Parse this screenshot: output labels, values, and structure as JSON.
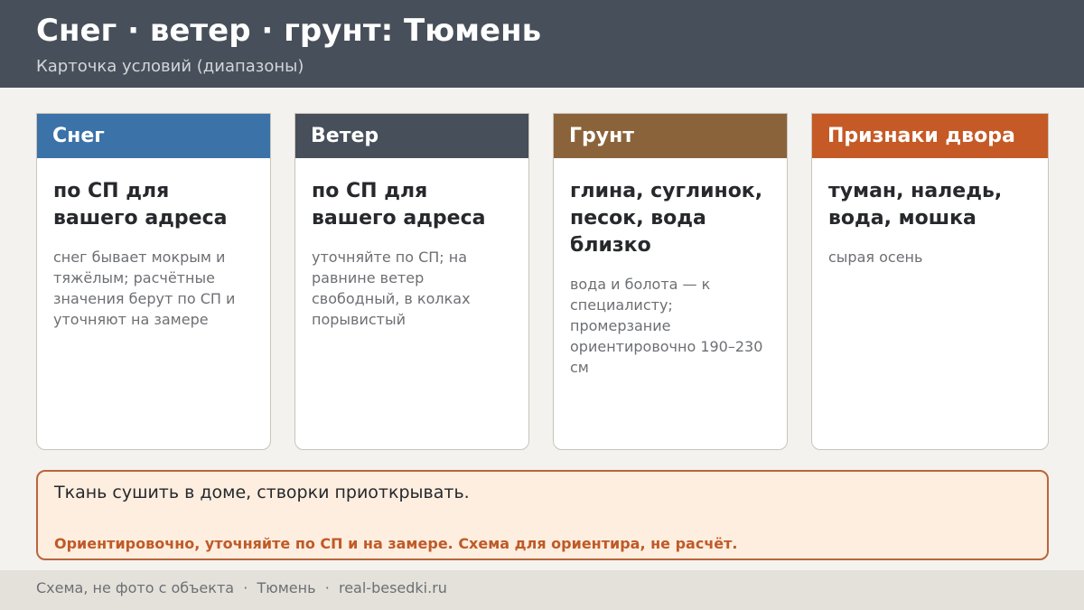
{
  "header": {
    "title": "Снег · ветер · грунт: Тюмень",
    "subtitle": "Карточка условий (диапазоны)"
  },
  "cards": [
    {
      "heading": "Снег",
      "color": "#3b72a8",
      "main": "по СП для вашего адреса",
      "note": "снег бывает мокрым и тяжёлым; расчётные значения берут по СП и уточняют на замере"
    },
    {
      "heading": "Ветер",
      "color": "#474f5a",
      "main": "по СП для вашего адреса",
      "note": "уточняйте по СП; на равнине ветер свободный, в колках порывистый"
    },
    {
      "heading": "Грунт",
      "color": "#8b633b",
      "main": "глина, суглинок, песок, вода близко",
      "note": "вода и болота — к специалисту; промерзание ориентировочно 190–230 см"
    },
    {
      "heading": "Признаки двора",
      "color": "#c55a27",
      "main": "туман, наледь, вода, мошка",
      "note": "сырая осень"
    }
  ],
  "advice": {
    "main": "Ткань сушить в доме, створки приоткрывать.",
    "warning": "Ориентировочно, уточняйте по СП и на замере. Схема для ориентира, не расчёт."
  },
  "footer": {
    "text": "Схема, не фото с объекта  ·  Тюмень  ·  real-besedki.ru"
  }
}
